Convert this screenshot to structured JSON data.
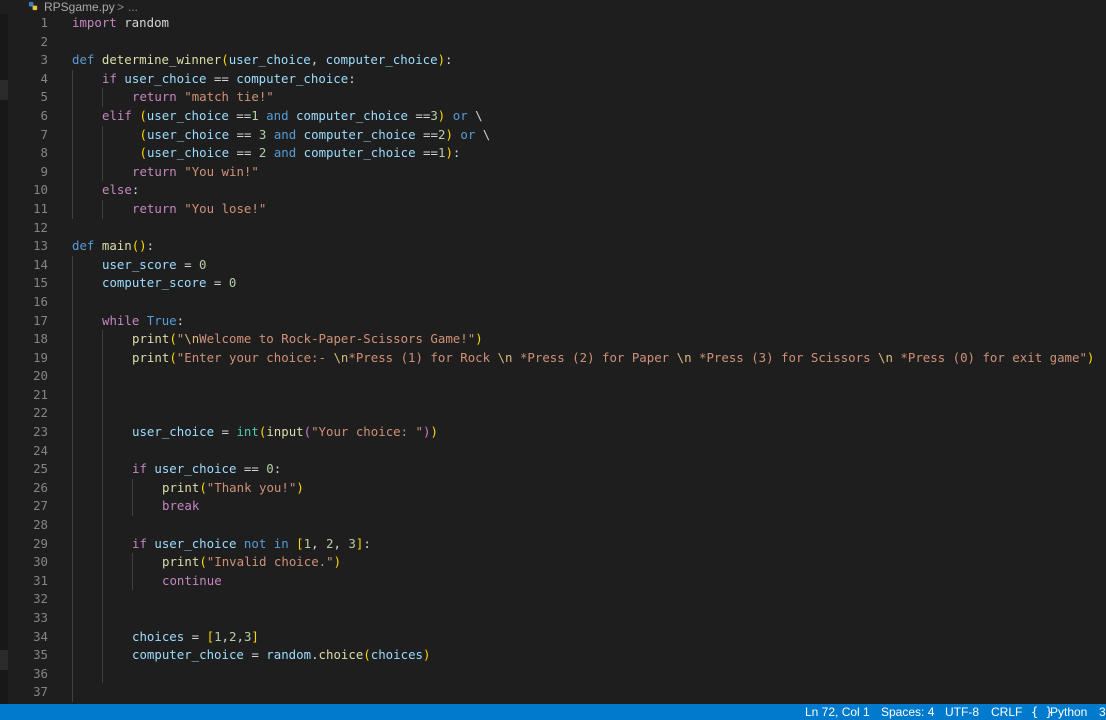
{
  "breadcrumb": {
    "filename": "RPSgame.py",
    "separator": ">",
    "ellipsis": "..."
  },
  "lines": [
    {
      "n": "1",
      "indent": 0,
      "t": [
        [
          "import",
          "ctl"
        ],
        [
          " random",
          ""
        ]
      ]
    },
    {
      "n": "2",
      "indent": 0,
      "t": []
    },
    {
      "n": "3",
      "indent": 0,
      "t": [
        [
          "def",
          "kw"
        ],
        [
          " ",
          ""
        ],
        [
          "determine_winner",
          "fn"
        ],
        [
          "(",
          "b1"
        ],
        [
          "user_choice",
          "var"
        ],
        [
          ", ",
          ""
        ],
        [
          "computer_choice",
          "var"
        ],
        [
          ")",
          "b1"
        ],
        [
          ":",
          ""
        ]
      ]
    },
    {
      "n": "4",
      "indent": 1,
      "t": [
        [
          "if",
          "ctl"
        ],
        [
          " ",
          ""
        ],
        [
          "user_choice",
          "var"
        ],
        [
          " == ",
          ""
        ],
        [
          "computer_choice",
          "var"
        ],
        [
          ":",
          ""
        ]
      ]
    },
    {
      "n": "5",
      "indent": 2,
      "t": [
        [
          "return",
          "ctl"
        ],
        [
          " ",
          ""
        ],
        [
          "\"match tie!\"",
          "str"
        ]
      ]
    },
    {
      "n": "6",
      "indent": 1,
      "t": [
        [
          "elif",
          "ctl"
        ],
        [
          " ",
          ""
        ],
        [
          "(",
          "b1"
        ],
        [
          "user_choice",
          "var"
        ],
        [
          " ==",
          ""
        ],
        [
          "1",
          "num"
        ],
        [
          " ",
          ""
        ],
        [
          "and",
          "kw"
        ],
        [
          " ",
          ""
        ],
        [
          "computer_choice",
          "var"
        ],
        [
          " ==",
          ""
        ],
        [
          "3",
          "num"
        ],
        [
          ")",
          "b1"
        ],
        [
          " ",
          ""
        ],
        [
          "or",
          "kw"
        ],
        [
          " \\",
          ""
        ]
      ]
    },
    {
      "n": "7",
      "indent": 2,
      "pre": " ",
      "t": [
        [
          "(",
          "b1"
        ],
        [
          "user_choice",
          "var"
        ],
        [
          " == ",
          ""
        ],
        [
          "3",
          "num"
        ],
        [
          " ",
          ""
        ],
        [
          "and",
          "kw"
        ],
        [
          " ",
          ""
        ],
        [
          "computer_choice",
          "var"
        ],
        [
          " ==",
          ""
        ],
        [
          "2",
          "num"
        ],
        [
          ")",
          "b1"
        ],
        [
          " ",
          ""
        ],
        [
          "or",
          "kw"
        ],
        [
          " \\",
          ""
        ]
      ]
    },
    {
      "n": "8",
      "indent": 2,
      "pre": " ",
      "t": [
        [
          "(",
          "b1"
        ],
        [
          "user_choice",
          "var"
        ],
        [
          " == ",
          ""
        ],
        [
          "2",
          "num"
        ],
        [
          " ",
          ""
        ],
        [
          "and",
          "kw"
        ],
        [
          " ",
          ""
        ],
        [
          "computer_choice",
          "var"
        ],
        [
          " ==",
          ""
        ],
        [
          "1",
          "num"
        ],
        [
          ")",
          "b1"
        ],
        [
          ":",
          ""
        ]
      ]
    },
    {
      "n": "9",
      "indent": 2,
      "t": [
        [
          "return",
          "ctl"
        ],
        [
          " ",
          ""
        ],
        [
          "\"You win!\"",
          "str"
        ]
      ]
    },
    {
      "n": "10",
      "indent": 1,
      "t": [
        [
          "else",
          "ctl"
        ],
        [
          ":",
          ""
        ]
      ]
    },
    {
      "n": "11",
      "indent": 2,
      "t": [
        [
          "return",
          "ctl"
        ],
        [
          " ",
          ""
        ],
        [
          "\"You lose!\"",
          "str"
        ]
      ]
    },
    {
      "n": "12",
      "indent": 0,
      "t": []
    },
    {
      "n": "13",
      "indent": 0,
      "t": [
        [
          "def",
          "kw"
        ],
        [
          " ",
          ""
        ],
        [
          "main",
          "fn"
        ],
        [
          "()",
          "b1"
        ],
        [
          ":",
          ""
        ]
      ]
    },
    {
      "n": "14",
      "indent": 1,
      "t": [
        [
          "user_score",
          "var"
        ],
        [
          " = ",
          ""
        ],
        [
          "0",
          "num"
        ]
      ]
    },
    {
      "n": "15",
      "indent": 1,
      "t": [
        [
          "computer_score",
          "var"
        ],
        [
          " = ",
          ""
        ],
        [
          "0",
          "num"
        ]
      ]
    },
    {
      "n": "16",
      "indent": 1,
      "t": []
    },
    {
      "n": "17",
      "indent": 1,
      "t": [
        [
          "while",
          "ctl"
        ],
        [
          " ",
          ""
        ],
        [
          "True",
          "kw"
        ],
        [
          ":",
          ""
        ]
      ]
    },
    {
      "n": "18",
      "indent": 2,
      "t": [
        [
          "print",
          "fn"
        ],
        [
          "(",
          "b1"
        ],
        [
          "\"",
          "str"
        ],
        [
          "\\n",
          "esc"
        ],
        [
          "Welcome to Rock-Paper-Scissors Game!\"",
          "str"
        ],
        [
          ")",
          "b1"
        ]
      ]
    },
    {
      "n": "19",
      "indent": 2,
      "t": [
        [
          "print",
          "fn"
        ],
        [
          "(",
          "b1"
        ],
        [
          "\"Enter your choice:- ",
          "str"
        ],
        [
          "\\n",
          "esc"
        ],
        [
          "*Press (1) for Rock ",
          "str"
        ],
        [
          "\\n",
          "esc"
        ],
        [
          " *Press (2) for Paper ",
          "str"
        ],
        [
          "\\n",
          "esc"
        ],
        [
          " *Press (3) for Scissors ",
          "str"
        ],
        [
          "\\n",
          "esc"
        ],
        [
          " *Press (0) for exit game\"",
          "str"
        ],
        [
          ")",
          "b1"
        ]
      ]
    },
    {
      "n": "20",
      "indent": 2,
      "t": []
    },
    {
      "n": "21",
      "indent": 2,
      "t": []
    },
    {
      "n": "22",
      "indent": 2,
      "t": []
    },
    {
      "n": "23",
      "indent": 2,
      "t": [
        [
          "user_choice",
          "var"
        ],
        [
          " = ",
          ""
        ],
        [
          "int",
          "cls"
        ],
        [
          "(",
          "b1"
        ],
        [
          "input",
          "fn"
        ],
        [
          "(",
          "b2"
        ],
        [
          "\"Your choice: \"",
          "str"
        ],
        [
          ")",
          "b2"
        ],
        [
          ")",
          "b1"
        ]
      ]
    },
    {
      "n": "24",
      "indent": 2,
      "t": []
    },
    {
      "n": "25",
      "indent": 2,
      "t": [
        [
          "if",
          "ctl"
        ],
        [
          " ",
          ""
        ],
        [
          "user_choice",
          "var"
        ],
        [
          " == ",
          ""
        ],
        [
          "0",
          "num"
        ],
        [
          ":",
          ""
        ]
      ]
    },
    {
      "n": "26",
      "indent": 3,
      "t": [
        [
          "print",
          "fn"
        ],
        [
          "(",
          "b1"
        ],
        [
          "\"Thank you!\"",
          "str"
        ],
        [
          ")",
          "b1"
        ]
      ]
    },
    {
      "n": "27",
      "indent": 3,
      "t": [
        [
          "break",
          "ctl"
        ]
      ]
    },
    {
      "n": "28",
      "indent": 2,
      "t": []
    },
    {
      "n": "29",
      "indent": 2,
      "t": [
        [
          "if",
          "ctl"
        ],
        [
          " ",
          ""
        ],
        [
          "user_choice",
          "var"
        ],
        [
          " ",
          ""
        ],
        [
          "not",
          "kw"
        ],
        [
          " ",
          ""
        ],
        [
          "in",
          "kw"
        ],
        [
          " ",
          ""
        ],
        [
          "[",
          "b1"
        ],
        [
          "1",
          "num"
        ],
        [
          ", ",
          ""
        ],
        [
          "2",
          "num"
        ],
        [
          ", ",
          ""
        ],
        [
          "3",
          "num"
        ],
        [
          "]",
          "b1"
        ],
        [
          ":",
          ""
        ]
      ]
    },
    {
      "n": "30",
      "indent": 3,
      "t": [
        [
          "print",
          "fn"
        ],
        [
          "(",
          "b1"
        ],
        [
          "\"Invalid choice.\"",
          "str"
        ],
        [
          ")",
          "b1"
        ]
      ]
    },
    {
      "n": "31",
      "indent": 3,
      "t": [
        [
          "continue",
          "ctl"
        ]
      ]
    },
    {
      "n": "32",
      "indent": 2,
      "t": []
    },
    {
      "n": "33",
      "indent": 2,
      "t": []
    },
    {
      "n": "34",
      "indent": 2,
      "t": [
        [
          "choices",
          "var"
        ],
        [
          " = ",
          ""
        ],
        [
          "[",
          "b1"
        ],
        [
          "1",
          "num"
        ],
        [
          ",",
          ""
        ],
        [
          "2",
          "num"
        ],
        [
          ",",
          ""
        ],
        [
          "3",
          "num"
        ],
        [
          "]",
          "b1"
        ]
      ]
    },
    {
      "n": "35",
      "indent": 2,
      "t": [
        [
          "computer_choice",
          "var"
        ],
        [
          " = ",
          ""
        ],
        [
          "random",
          "var"
        ],
        [
          ".",
          ""
        ],
        [
          "choice",
          "fn"
        ],
        [
          "(",
          "b1"
        ],
        [
          "choices",
          "var"
        ],
        [
          ")",
          "b1"
        ]
      ]
    },
    {
      "n": "36",
      "indent": 2,
      "t": []
    },
    {
      "n": "37",
      "indent": 1,
      "t": []
    }
  ],
  "statusbar": {
    "position": "Ln 72, Col 1",
    "spaces": "Spaces: 4",
    "encoding": "UTF-8",
    "eol": "CRLF",
    "braces_icon": "{ }",
    "language": "Python",
    "trailing": "3"
  },
  "colors": {
    "background": "#1e1e1e",
    "statusbar": "#007acc",
    "keyword": "#569cd6",
    "control": "#c586c0",
    "function": "#dcdcaa",
    "variable": "#9cdcfe",
    "string": "#ce9178",
    "number": "#b5cea8"
  },
  "icons": {
    "file": "python-file-icon",
    "language": "braces-icon"
  }
}
